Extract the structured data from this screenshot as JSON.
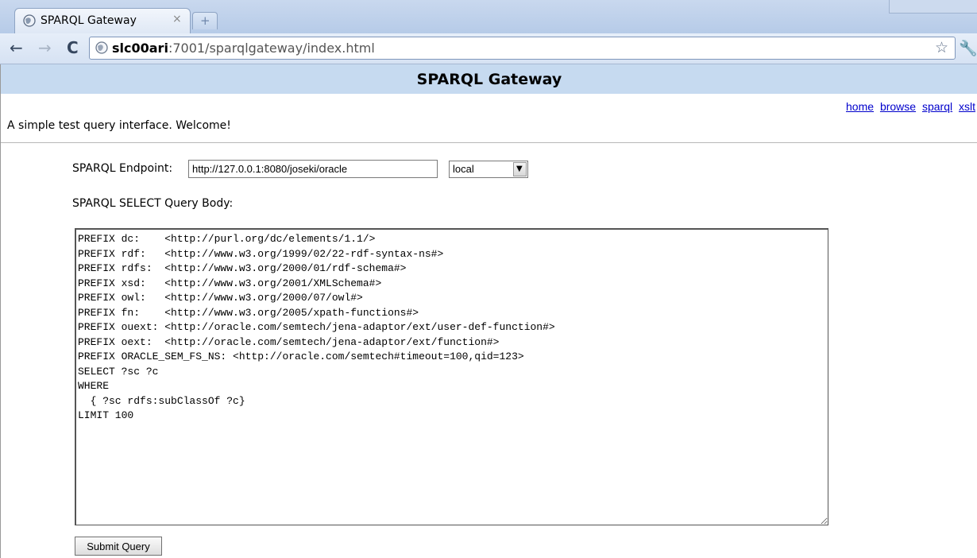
{
  "browser": {
    "tab_title": "SPARQL Gateway",
    "tab_close": "×",
    "new_tab": "+",
    "url_host": "slc00ari",
    "url_rest": ":7001/sparqlgateway/index.html"
  },
  "page": {
    "title": "SPARQL Gateway",
    "links": [
      "home",
      "browse",
      "sparql",
      "xslt"
    ],
    "welcome": "A simple test query interface. Welcome!",
    "endpoint_label": "SPARQL Endpoint:",
    "endpoint_value": "http://127.0.0.1:8080/joseki/oracle",
    "endpoint_select": "local",
    "query_label": "SPARQL SELECT Query Body:",
    "query_text": "PREFIX dc:    <http://purl.org/dc/elements/1.1/>\nPREFIX rdf:   <http://www.w3.org/1999/02/22-rdf-syntax-ns#>\nPREFIX rdfs:  <http://www.w3.org/2000/01/rdf-schema#>\nPREFIX xsd:   <http://www.w3.org/2001/XMLSchema#>\nPREFIX owl:   <http://www.w3.org/2000/07/owl#>\nPREFIX fn:    <http://www.w3.org/2005/xpath-functions#>\nPREFIX ouext: <http://oracle.com/semtech/jena-adaptor/ext/user-def-function#>\nPREFIX oext:  <http://oracle.com/semtech/jena-adaptor/ext/function#>\nPREFIX ORACLE_SEM_FS_NS: <http://oracle.com/semtech#timeout=100,qid=123>\nSELECT ?sc ?c\nWHERE\n  { ?sc rdfs:subClassOf ?c}\nLIMIT 100",
    "submit_label": "Submit Query"
  }
}
